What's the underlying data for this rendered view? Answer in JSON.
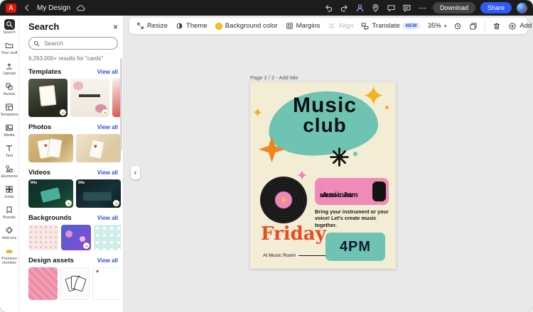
{
  "topbar": {
    "title": "My Design",
    "download_label": "Download",
    "share_label": "Share"
  },
  "rail": {
    "items": [
      {
        "id": "search",
        "label": "Search"
      },
      {
        "id": "your-stuff",
        "label": "Your stuff"
      },
      {
        "id": "upload",
        "label": "Upload"
      },
      {
        "id": "assets",
        "label": "Assets"
      },
      {
        "id": "templates",
        "label": "Templates"
      },
      {
        "id": "media",
        "label": "Media"
      },
      {
        "id": "text",
        "label": "Text"
      },
      {
        "id": "elements",
        "label": "Elements"
      },
      {
        "id": "grids",
        "label": "Grids"
      },
      {
        "id": "brands",
        "label": "Brands"
      },
      {
        "id": "add-ons",
        "label": "Add-ons"
      },
      {
        "id": "premium",
        "label": "Premium member"
      }
    ]
  },
  "panel": {
    "title": "Search",
    "search_placeholder": "Search",
    "results_text": "6,263,000+ results for \"cards\"",
    "view_all": "View all",
    "sections": {
      "templates": {
        "title": "Templates"
      },
      "photos": {
        "title": "Photos"
      },
      "videos": {
        "title": "Videos",
        "durations": [
          "04s",
          "04s"
        ]
      },
      "backgrounds": {
        "title": "Backgrounds"
      },
      "design_assets": {
        "title": "Design assets"
      }
    }
  },
  "toolbar": {
    "resize": "Resize",
    "theme": "Theme",
    "background_color": "Background color",
    "margins": "Margins",
    "align": "Align",
    "translate": "Translate",
    "new_badge": "NEW",
    "zoom": "35%",
    "add": "Add"
  },
  "canvas": {
    "page_label": "Page 2 / 2 - Add title",
    "poster": {
      "title_line1": "Music",
      "title_line2": "club",
      "banner_line1": "Music Jam",
      "banner_line2": "Sessions",
      "body": "Bring your instrument or your voice! Let's create music together.",
      "day": "Friday",
      "location": "At Music Room",
      "time": "4PM"
    }
  },
  "colors": {
    "share_blue": "#2f5af5",
    "adobe_red": "#eb1000",
    "link_blue": "#2e53da",
    "poster_cream": "#f3edd6",
    "poster_teal": "#6fc3b2",
    "poster_pink": "#f08ab8",
    "poster_orange": "#e84b1f",
    "poster_yellow": "#f2b51c",
    "poster_black": "#141414"
  }
}
